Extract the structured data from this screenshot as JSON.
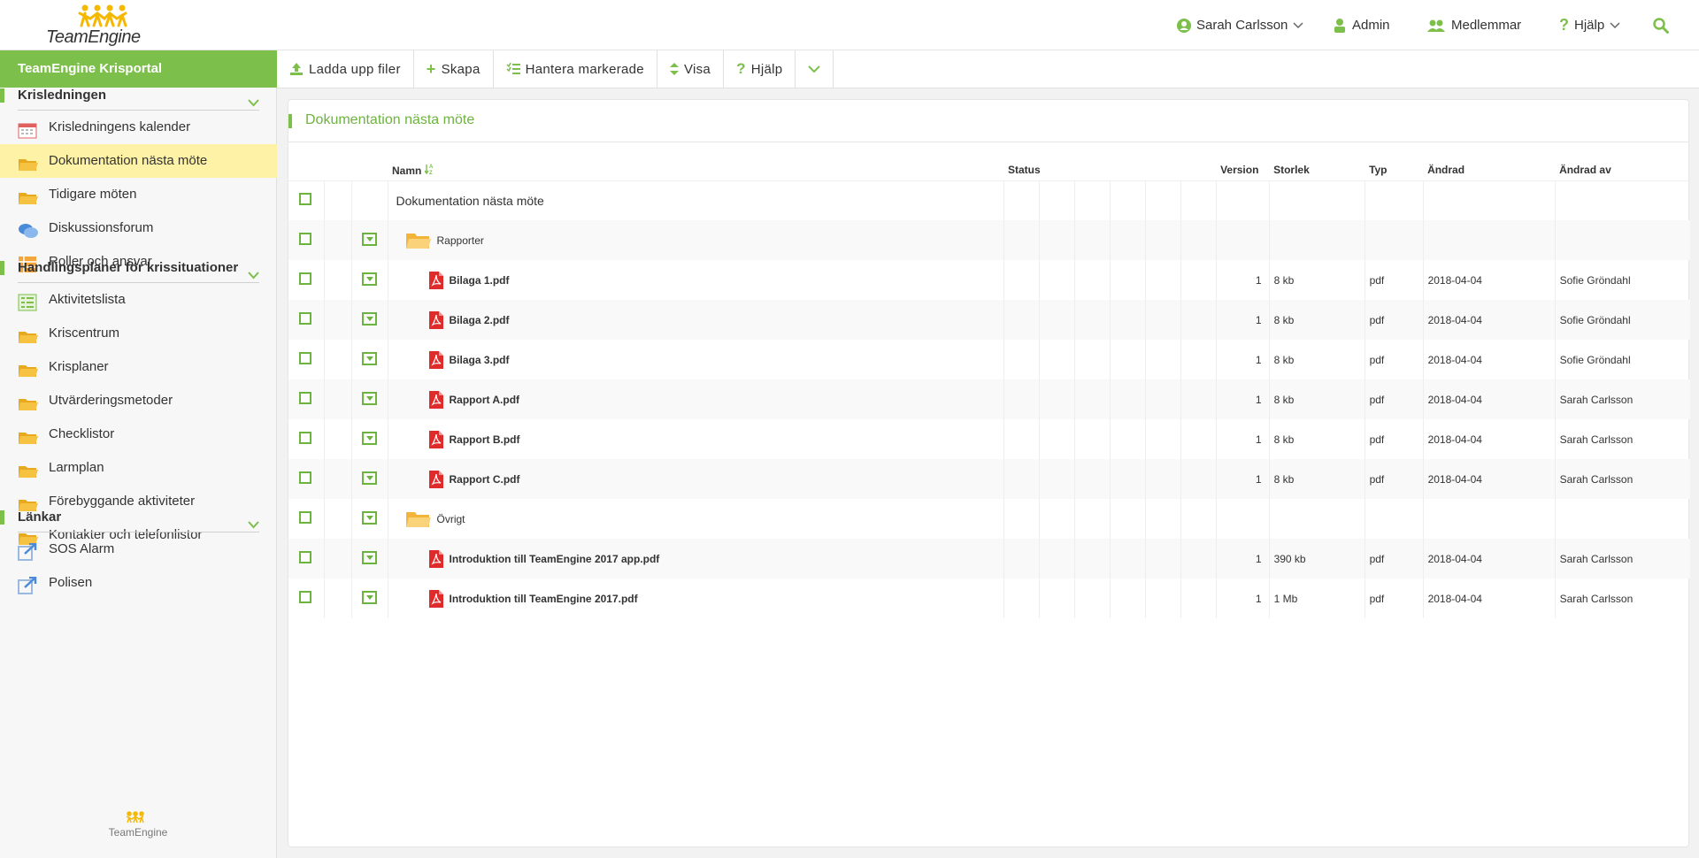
{
  "header": {
    "logo_text": "TeamEngine",
    "user": "Sarah Carlsson",
    "admin": "Admin",
    "members": "Medlemmar",
    "help": "Hjälp"
  },
  "sidebar": {
    "portal": "TeamEngine Krisportal",
    "sections": [
      {
        "title": "Krisledningen",
        "items": [
          {
            "label": "Krisledningens kalender",
            "icon": "calendar-icon"
          },
          {
            "label": "Dokumentation nästa möte",
            "icon": "folder-icon",
            "active": true
          },
          {
            "label": "Tidigare möten",
            "icon": "folder-icon"
          },
          {
            "label": "Diskussionsforum",
            "icon": "chat-icon"
          },
          {
            "label": "Roller och ansvar",
            "icon": "list-icon"
          }
        ]
      },
      {
        "title": "Handlingsplaner för krissituationer",
        "items": [
          {
            "label": "Aktivitetslista",
            "icon": "checklist-icon"
          },
          {
            "label": "Kriscentrum",
            "icon": "folder-icon"
          },
          {
            "label": "Krisplaner",
            "icon": "folder-icon"
          },
          {
            "label": "Utvärderingsmetoder",
            "icon": "folder-icon"
          },
          {
            "label": "Checklistor",
            "icon": "folder-icon"
          },
          {
            "label": "Larmplan",
            "icon": "folder-icon"
          },
          {
            "label": "Förebyggande aktiviteter",
            "icon": "folder-icon"
          },
          {
            "label": "Kontakter och telefonlistor",
            "icon": "folder-icon"
          }
        ]
      },
      {
        "title": "Länkar",
        "items": [
          {
            "label": "SOS Alarm",
            "icon": "external-link-icon"
          },
          {
            "label": "Polisen",
            "icon": "external-link-icon"
          }
        ]
      }
    ],
    "footer_logo": "TeamEngine"
  },
  "toolbar": {
    "upload": "Ladda upp filer",
    "create": "Skapa",
    "manage": "Hantera markerade",
    "show": "Visa",
    "help": "Hjälp"
  },
  "panel": {
    "title": "Dokumentation nästa möte",
    "columns": {
      "name": "Namn",
      "status": "Status",
      "version": "Version",
      "size": "Storlek",
      "type": "Typ",
      "changed": "Ändrad",
      "changed_by": "Ändrad av"
    },
    "root_label": "Dokumentation nästa möte",
    "rows": [
      {
        "kind": "folder",
        "name": "Rapporter",
        "version": "",
        "size": "",
        "type": "",
        "changed": "",
        "by": ""
      },
      {
        "kind": "pdf",
        "name": "Bilaga 1.pdf",
        "version": "1",
        "size": "8 kb",
        "type": "pdf",
        "changed": "2018-04-04",
        "by": "Sofie Gröndahl"
      },
      {
        "kind": "pdf",
        "name": "Bilaga 2.pdf",
        "version": "1",
        "size": "8 kb",
        "type": "pdf",
        "changed": "2018-04-04",
        "by": "Sofie Gröndahl"
      },
      {
        "kind": "pdf",
        "name": "Bilaga 3.pdf",
        "version": "1",
        "size": "8 kb",
        "type": "pdf",
        "changed": "2018-04-04",
        "by": "Sofie Gröndahl"
      },
      {
        "kind": "pdf",
        "name": "Rapport A.pdf",
        "version": "1",
        "size": "8 kb",
        "type": "pdf",
        "changed": "2018-04-04",
        "by": "Sarah Carlsson"
      },
      {
        "kind": "pdf",
        "name": "Rapport B.pdf",
        "version": "1",
        "size": "8 kb",
        "type": "pdf",
        "changed": "2018-04-04",
        "by": "Sarah Carlsson"
      },
      {
        "kind": "pdf",
        "name": "Rapport C.pdf",
        "version": "1",
        "size": "8 kb",
        "type": "pdf",
        "changed": "2018-04-04",
        "by": "Sarah Carlsson"
      },
      {
        "kind": "folder",
        "name": "Övrigt",
        "version": "",
        "size": "",
        "type": "",
        "changed": "",
        "by": ""
      },
      {
        "kind": "pdf",
        "name": "Introduktion till TeamEngine 2017 app.pdf",
        "version": "1",
        "size": "390 kb",
        "type": "pdf",
        "changed": "2018-04-04",
        "by": "Sarah Carlsson"
      },
      {
        "kind": "pdf",
        "name": "Introduktion till TeamEngine 2017.pdf",
        "version": "1",
        "size": "1 Mb",
        "type": "pdf",
        "changed": "2018-04-04",
        "by": "Sarah Carlsson"
      }
    ]
  },
  "colors": {
    "accent": "#7cbf4a",
    "accent_text": "#6db33f",
    "active_bg": "#fdf2a6",
    "folder": "#f5c242",
    "pdf": "#e02b2b"
  }
}
